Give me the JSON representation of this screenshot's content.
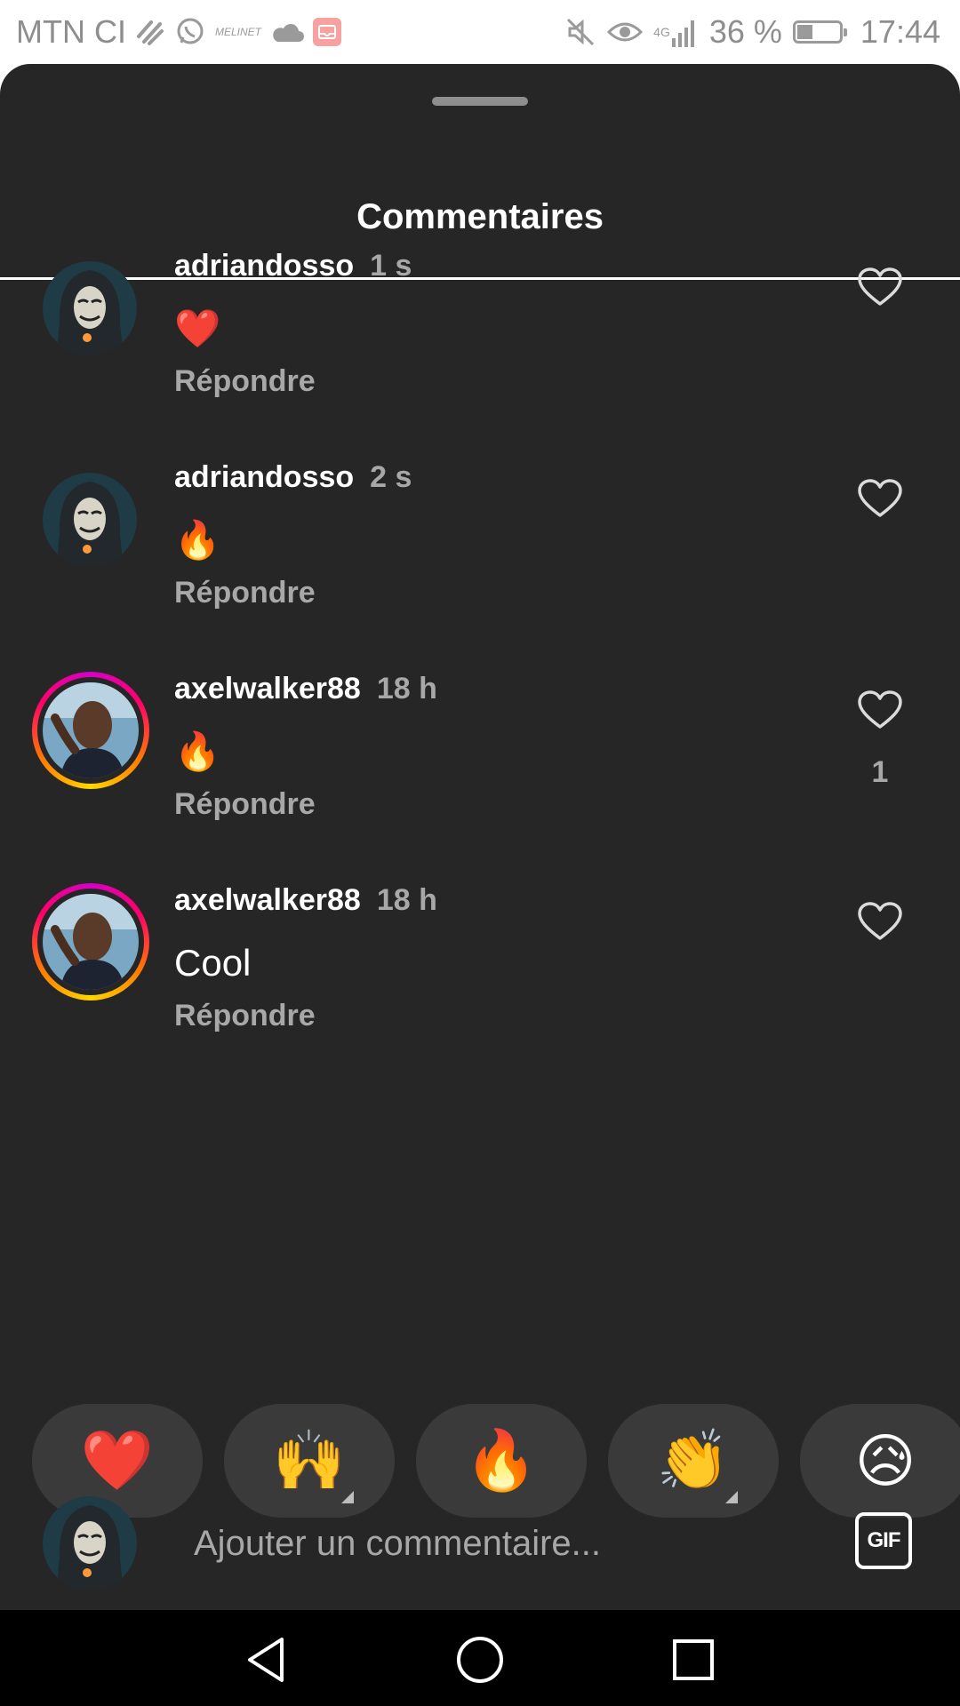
{
  "status_bar": {
    "carrier": "MTN CI",
    "battery_percent": "36 %",
    "battery_level": 0.36,
    "time": "17:44",
    "network": "4G",
    "left_icons": [
      "swirl-icon",
      "whatsapp-icon",
      "app-icon",
      "cloud-icon",
      "gallery-icon"
    ],
    "app_icon_text": "MELINET",
    "right_icons": [
      "mute-icon",
      "eye-icon",
      "signal-icon",
      "battery-icon"
    ]
  },
  "sheet": {
    "title": "Commentaires"
  },
  "comments": [
    {
      "username": "adriandosso",
      "time": "1 s",
      "text": "❤️",
      "reply_label": "Répondre",
      "likes": "",
      "avatar": "hooded-mask",
      "story_ring": false
    },
    {
      "username": "adriandosso",
      "time": "2 s",
      "text": "🔥",
      "reply_label": "Répondre",
      "likes": "",
      "avatar": "hooded-mask",
      "story_ring": false
    },
    {
      "username": "axelwalker88",
      "time": "18 h",
      "text": "🔥",
      "reply_label": "Répondre",
      "likes": "1",
      "avatar": "portrait",
      "story_ring": true
    },
    {
      "username": "axelwalker88",
      "time": "18 h",
      "text": "Cool",
      "reply_label": "Répondre",
      "likes": "",
      "avatar": "portrait",
      "story_ring": true
    }
  ],
  "reactions": [
    {
      "emoji": "❤️",
      "name": "heart",
      "has_variants": false
    },
    {
      "emoji": "🙌",
      "name": "raising-hands",
      "has_variants": true
    },
    {
      "emoji": "🔥",
      "name": "fire",
      "has_variants": false
    },
    {
      "emoji": "👏",
      "name": "clapping-hands",
      "has_variants": true
    },
    {
      "emoji": "😥",
      "name": "sad-face",
      "has_variants": false
    }
  ],
  "composer": {
    "placeholder": "Ajouter un commentaire...",
    "gif_label": "GIF"
  },
  "colors": {
    "background": "#262626",
    "secondary_text": "#a8a8a8",
    "pill": "#3a3a3a",
    "heart": "#e8507a"
  }
}
